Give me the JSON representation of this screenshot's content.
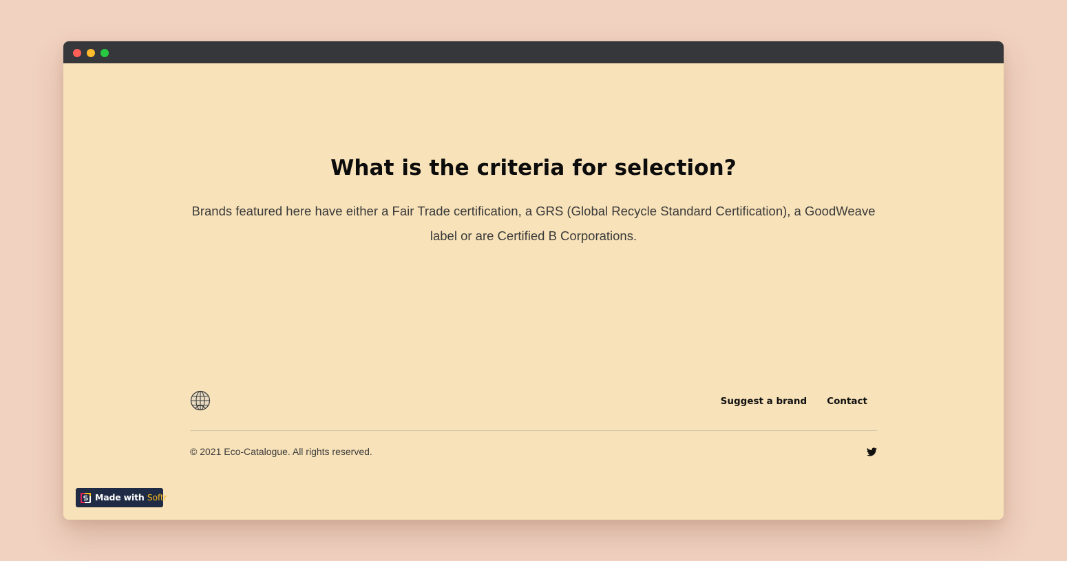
{
  "window": {
    "controls": [
      "close",
      "minimize",
      "maximize"
    ]
  },
  "section": {
    "heading": "What is the criteria for selection?",
    "body": "Brands featured here have either a Fair Trade certification, a GRS (Global Recycle Standard Certification), a GoodWeave label or are Certified B Corporations."
  },
  "footer": {
    "logo_icon": "globe-icon",
    "nav": {
      "suggest_label": "Suggest a brand",
      "contact_label": "Contact"
    },
    "copyright": "© 2021 Eco-Catalogue. All rights reserved.",
    "social_icon": "twitter-icon"
  },
  "badge": {
    "prefix": "Made with",
    "brand": "Softr",
    "icon": "softr-logo-icon"
  },
  "colors": {
    "page_background": "#f1d1c0",
    "window_background": "#f8e2b9",
    "titlebar": "#36373a",
    "badge_background": "#1f2a44",
    "badge_accent": "#f5b81b"
  }
}
